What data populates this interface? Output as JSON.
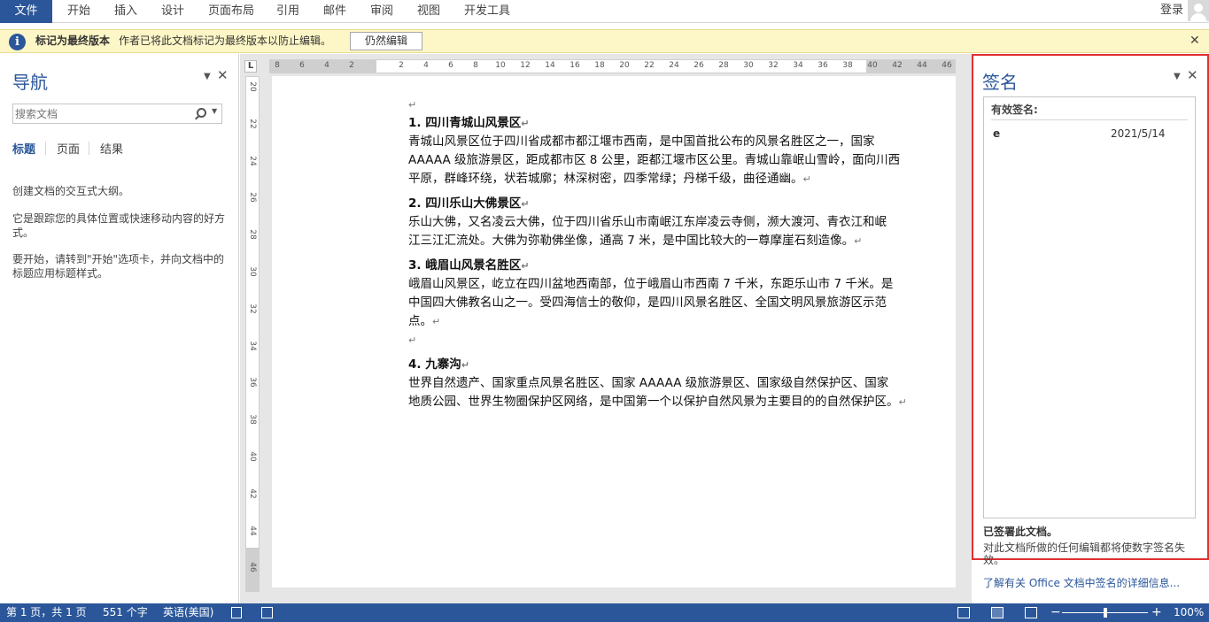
{
  "ribbon": {
    "file": "文件",
    "tabs": [
      "开始",
      "插入",
      "设计",
      "页面布局",
      "引用",
      "邮件",
      "审阅",
      "视图",
      "开发工具"
    ],
    "login": "登录"
  },
  "message_bar": {
    "title": "标记为最终版本",
    "text": "作者已将此文档标记为最终版本以防止编辑。",
    "button": "仍然编辑"
  },
  "nav": {
    "title": "导航",
    "search_placeholder": "搜索文档",
    "tabs": [
      "标题",
      "页面",
      "结果"
    ],
    "text1": "创建文档的交互式大纲。",
    "text2": "它是跟踪您的具体位置或快速移动内容的好方式。",
    "text3": "要开始，请转到\"开始\"选项卡，并向文档中的标题应用标题样式。"
  },
  "ruler": {
    "h": [
      "8",
      "6",
      "4",
      "2",
      "2",
      "4",
      "6",
      "8",
      "10",
      "12",
      "14",
      "16",
      "18",
      "20",
      "22",
      "24",
      "26",
      "28",
      "30",
      "32",
      "34",
      "36",
      "38",
      "40",
      "42",
      "44",
      "46"
    ],
    "v": [
      "20",
      "22",
      "24",
      "26",
      "28",
      "30",
      "32",
      "34",
      "36",
      "38",
      "40",
      "42",
      "44",
      "46"
    ],
    "corner": "L"
  },
  "doc": {
    "sections": [
      {
        "heading": "1.  四川青城山风景区",
        "lines": [
          "青城山风景区位于四川省成都市都江堰市西南，是中国首批公布的风景名胜区之一，国家",
          "AAAAA 级旅游景区，距成都市区 8 公里，距都江堰市区公里。青城山靠岷山雪岭，面向川西",
          "平原，群峰环绕，状若城廓；林深树密，四季常绿；丹梯千级，曲径通幽。"
        ]
      },
      {
        "heading": "2.  四川乐山大佛景区",
        "lines": [
          "乐山大佛，又名凌云大佛，位于四川省乐山市南岷江东岸凌云寺侧，濒大渡河、青衣江和岷",
          "江三江汇流处。大佛为弥勒佛坐像，通高 7 米，是中国比较大的一尊摩崖石刻造像。"
        ]
      },
      {
        "heading": "3.  峨眉山风景名胜区",
        "lines": [
          "峨眉山风景区，屹立在四川盆地西南部，位于峨眉山市西南 7 千米，东距乐山市 7 千米。是",
          "中国四大佛教名山之一。受四海信士的敬仰，是四川风景名胜区、全国文明风景旅游区示范",
          "点。"
        ]
      },
      {
        "heading": "4.  九寨沟",
        "lines": [
          "世界自然遗产、国家重点风景名胜区、国家 AAAAA 级旅游景区、国家级自然保护区、国家",
          "地质公园、世界生物圈保护区网络，是中国第一个以保护自然风景为主要目的的自然保护区。"
        ]
      }
    ]
  },
  "signatures": {
    "title": "签名",
    "valid_header": "有效签名:",
    "signer": "e",
    "date": "2021/5/14",
    "signed_text": "已签署此文档。",
    "warning": "对此文档所做的任何编辑都将使数字签名失效。",
    "link": "了解有关 Office 文档中签名的详细信息..."
  },
  "status": {
    "page": "第 1 页，共 1 页",
    "words": "551 个字",
    "lang": "英语(美国)",
    "zoom": "100%",
    "zoom_level": 0.5
  },
  "colors": {
    "accent": "#2b579a",
    "message_bg": "#fdf6c6",
    "highlight_border": "#e03030"
  }
}
